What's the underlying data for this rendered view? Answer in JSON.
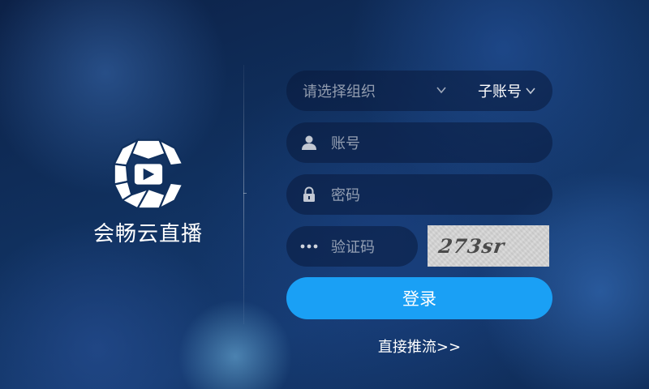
{
  "brand": {
    "title": "会畅云直播",
    "logo_icon": "camera-play-logo-icon"
  },
  "form": {
    "org_select": {
      "placeholder": "请选择组织",
      "icon": "chevron-down-icon"
    },
    "sub_account": {
      "label": "子账号",
      "icon": "chevron-down-icon"
    },
    "account": {
      "placeholder": "账号",
      "icon": "user-icon"
    },
    "password": {
      "placeholder": "密码",
      "icon": "lock-icon"
    },
    "captcha": {
      "placeholder": "验证码",
      "icon": "dots-icon",
      "image_text": "273sr"
    },
    "login_label": "登录",
    "push_link": "直接推流>>"
  },
  "colors": {
    "accent": "#1aa0f5",
    "background": "#10305e",
    "field_bg": "#0a193c"
  }
}
